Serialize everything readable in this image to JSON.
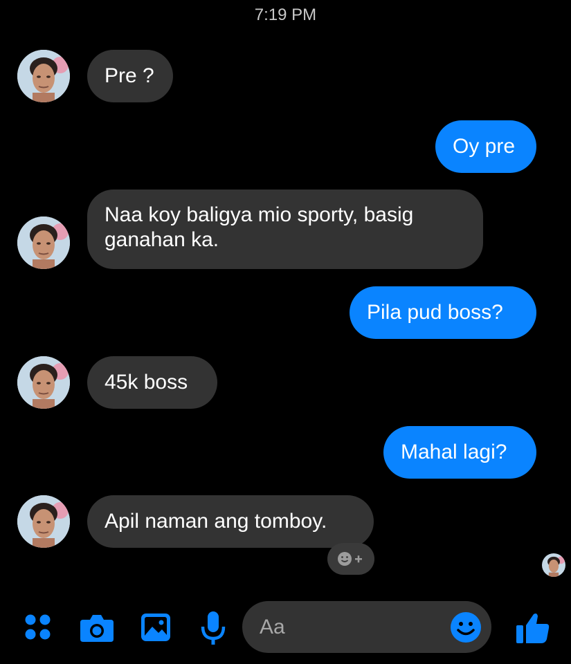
{
  "timestamp": "7:19 PM",
  "messages": [
    {
      "side": "in",
      "text": "Pre ?"
    },
    {
      "side": "out",
      "text": "Oy pre"
    },
    {
      "side": "in",
      "lines": [
        "Naa koy baligya mio sporty, basig",
        "ganahan ka."
      ]
    },
    {
      "side": "out",
      "text": "Pila pud boss?"
    },
    {
      "side": "in",
      "text": "45k boss"
    },
    {
      "side": "out",
      "text": "Mahal lagi?"
    },
    {
      "side": "in",
      "text": "Apil naman ang tomboy."
    }
  ],
  "composer": {
    "placeholder": "Aa",
    "icons": [
      "apps-icon",
      "camera-icon",
      "gallery-icon",
      "microphone-icon",
      "emoji-icon",
      "like-icon"
    ]
  },
  "colors": {
    "accent": "#0a84ff",
    "incoming_bubble": "#333333",
    "background": "#000000"
  }
}
